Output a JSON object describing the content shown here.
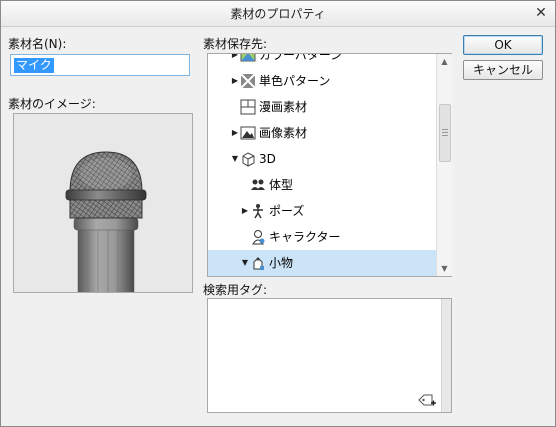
{
  "window": {
    "title": "素材のプロパティ"
  },
  "name_field": {
    "label": "素材名(N):",
    "value": "マイク"
  },
  "image_section": {
    "label": "素材のイメージ:"
  },
  "save_location": {
    "label": "素材保存先:",
    "items": [
      {
        "label": "カラーパターン",
        "expander": "right",
        "icon": "color-pattern-icon",
        "indent": 1
      },
      {
        "label": "単色パターン",
        "expander": "right",
        "icon": "monochrome-pattern-icon",
        "indent": 1
      },
      {
        "label": "漫画素材",
        "expander": "none",
        "icon": "manga-material-icon",
        "indent": 1
      },
      {
        "label": "画像素材",
        "expander": "right",
        "icon": "image-material-icon",
        "indent": 1
      },
      {
        "label": "3D",
        "expander": "down",
        "icon": "cube-icon",
        "indent": 1
      },
      {
        "label": "体型",
        "expander": "none",
        "icon": "body-type-icon",
        "indent": 2
      },
      {
        "label": "ポーズ",
        "expander": "right",
        "icon": "pose-icon",
        "indent": 2
      },
      {
        "label": "キャラクター",
        "expander": "none",
        "icon": "character-icon",
        "indent": 2
      },
      {
        "label": "小物",
        "expander": "down",
        "icon": "small-object-icon",
        "indent": 2,
        "selected": true
      }
    ]
  },
  "search_tags": {
    "label": "検索用タグ:"
  },
  "buttons": {
    "ok": "OK",
    "cancel": "キャンセル"
  },
  "colors": {
    "selection": "#3399ff",
    "tree_selected": "#cce4f7",
    "input_focus_border": "#7fb4e5"
  }
}
